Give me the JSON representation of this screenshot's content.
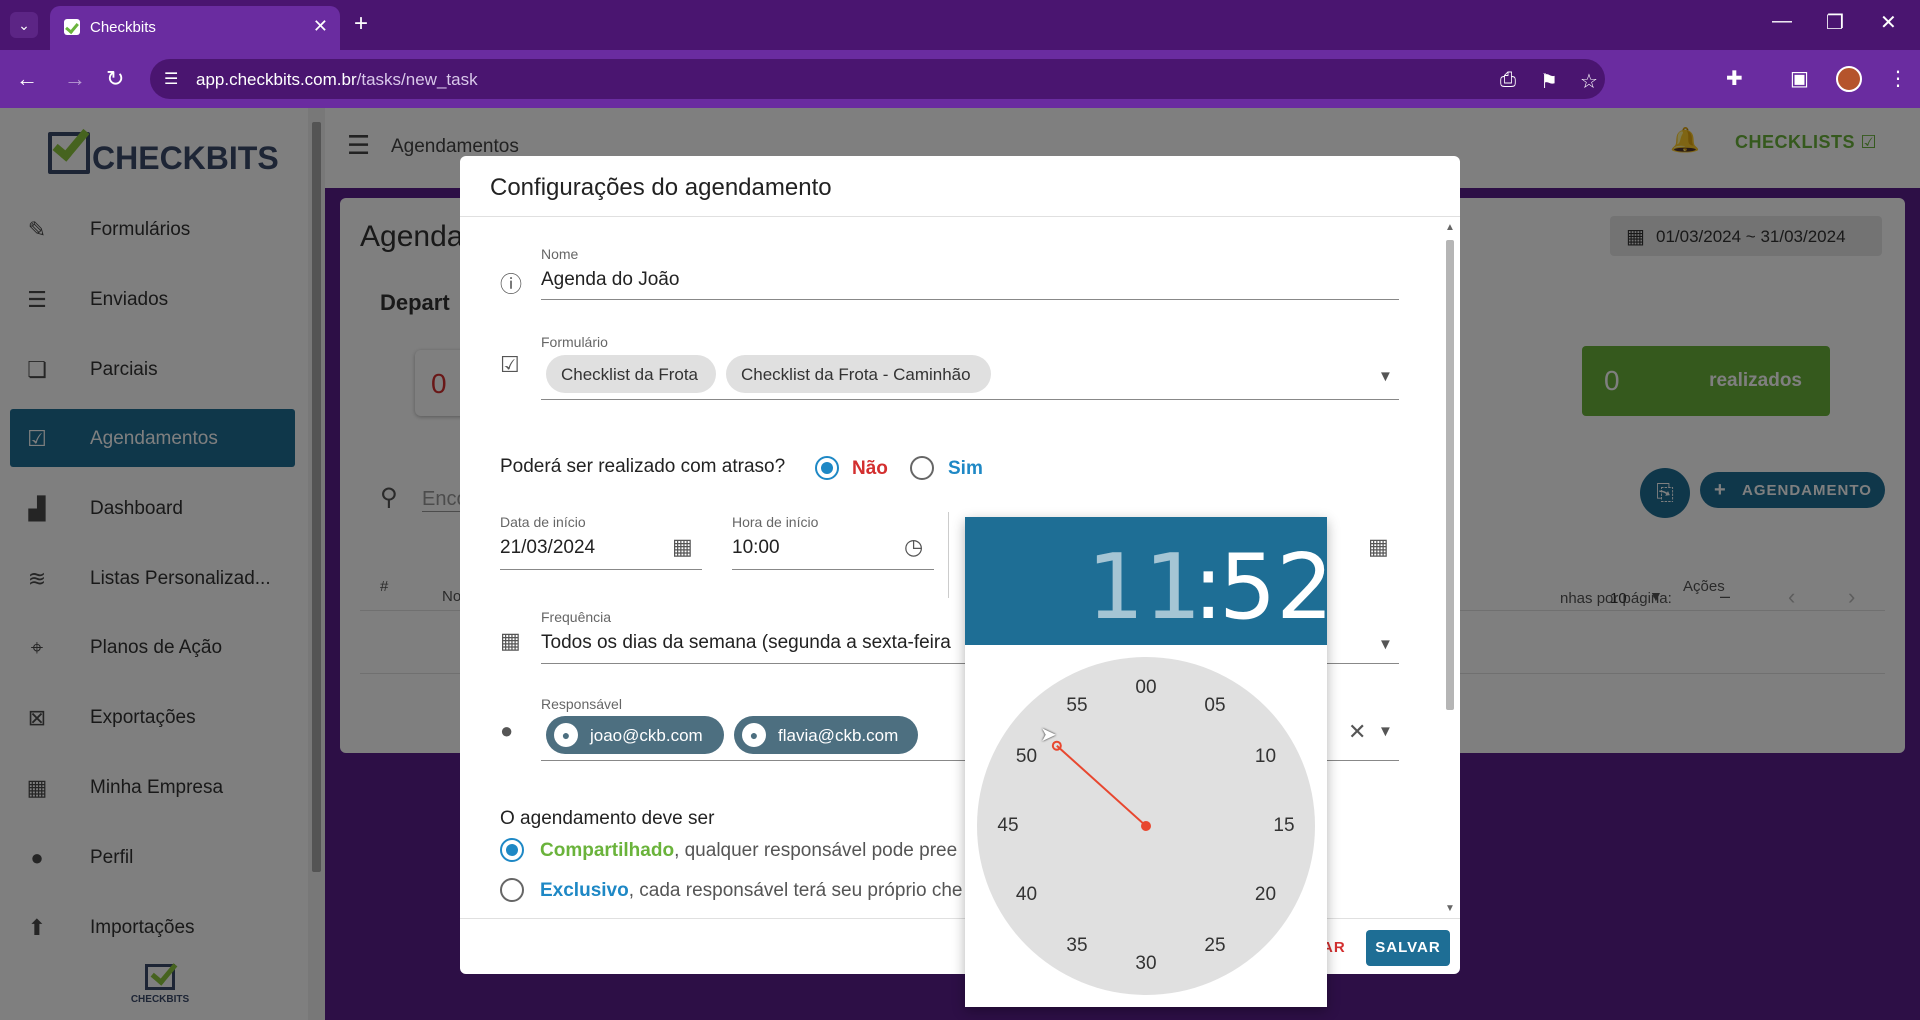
{
  "browser": {
    "tab_title": "Checkbits",
    "url_host": "app.checkbits.com.br",
    "url_path": "/tasks/new_task"
  },
  "sidebar": {
    "logo_text": "CHECKBITS",
    "footer_logo_text": "CHECKBITS",
    "items": [
      {
        "label": "Formulários",
        "icon": "form-icon"
      },
      {
        "label": "Enviados",
        "icon": "sent-icon"
      },
      {
        "label": "Parciais",
        "icon": "partial-icon"
      },
      {
        "label": "Agendamentos",
        "icon": "calendar-check-icon",
        "active": true
      },
      {
        "label": "Dashboard",
        "icon": "bar-chart-icon"
      },
      {
        "label": "Listas Personalizad...",
        "icon": "database-icon"
      },
      {
        "label": "Planos de Ação",
        "icon": "target-icon"
      },
      {
        "label": "Exportações",
        "icon": "excel-icon"
      },
      {
        "label": "Minha Empresa",
        "icon": "building-icon"
      },
      {
        "label": "Perfil",
        "icon": "person-icon"
      },
      {
        "label": "Importações",
        "icon": "import-icon"
      }
    ]
  },
  "topbar": {
    "page_name": "Agendamentos",
    "checklists_label": "CHECKLISTS"
  },
  "page": {
    "title": "Agenda",
    "department": "Depart",
    "stat_red_value": "0",
    "search_placeholder": "Enco",
    "col_hash": "#",
    "col_no": "No",
    "col_actions": "Ações",
    "date_range": "01/03/2024 ~ 31/03/2024",
    "done_count": "0",
    "done_label": "realizados",
    "new_button": "AGENDAMENTO",
    "rows_per_page_label": "nhas por página:",
    "rows_per_page_value": "10",
    "pagination_dash": "–"
  },
  "modal": {
    "title": "Configurações do agendamento",
    "name_label": "Nome",
    "name_value": "Agenda do João",
    "form_label": "Formulário",
    "forms": [
      "Checklist da Frota",
      "Checklist da Frota - Caminhão"
    ],
    "late_question": "Poderá ser realizado com atraso?",
    "late_no": "Não",
    "late_yes": "Sim",
    "late_selected": "Não",
    "start_date_label": "Data de início",
    "start_date_value": "21/03/2024",
    "start_time_label": "Hora de início",
    "start_time_value": "10:00",
    "frequency_label": "Frequência",
    "frequency_value": "Todos os dias da semana (segunda a sexta-feira",
    "responsible_label": "Responsável",
    "responsibles": [
      "joao@ckb.com",
      "flavia@ckb.com"
    ],
    "share_question": "O agendamento deve ser",
    "shared_strong": "Compartilhado",
    "shared_rest": ", qualquer responsável pode pree",
    "exclusive_strong": "Exclusivo",
    "exclusive_rest": ", cada responsável terá seu próprio che",
    "cancel_partial": "AR",
    "save_label": "SALVAR"
  },
  "time_picker": {
    "hour": "11",
    "colon": ":",
    "minute": "52",
    "dial_labels": [
      "00",
      "05",
      "10",
      "15",
      "20",
      "25",
      "30",
      "35",
      "40",
      "45",
      "50",
      "55"
    ],
    "selected_minute": 52
  },
  "colors": {
    "primary": "#1e6e95",
    "brand_green": "#6ab33b",
    "browser_purple": "#6a2ca0",
    "danger_red": "#d32f2f",
    "hand_red": "#e8472f"
  }
}
